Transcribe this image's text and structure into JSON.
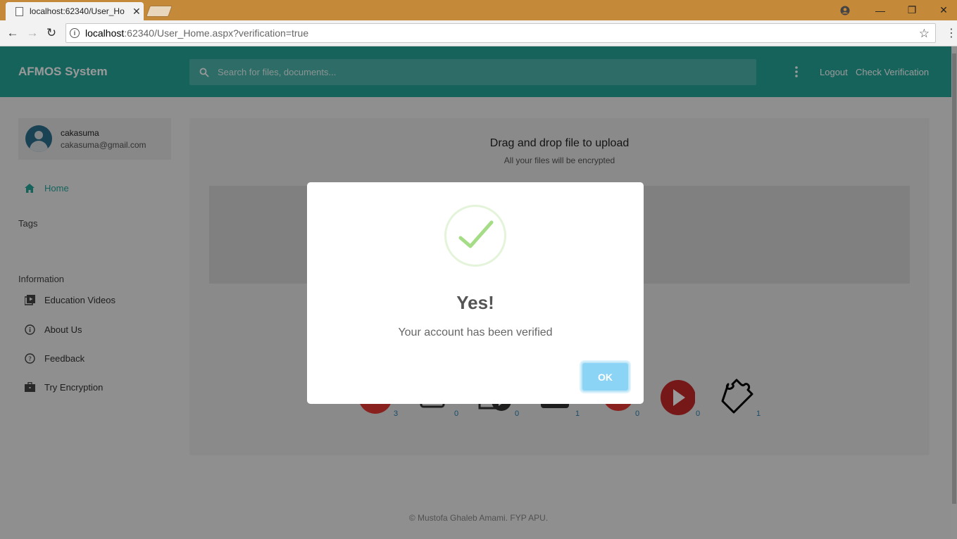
{
  "browser": {
    "tab_title": "localhost:62340/User_Ho",
    "url_host": "localhost",
    "url_rest": ":62340/User_Home.aspx?verification=true"
  },
  "header": {
    "brand": "AFMOS System",
    "search_placeholder": "Search for files, documents...",
    "logout": "Logout",
    "check_verification": "Check Verification"
  },
  "user": {
    "name": "cakasuma",
    "email": "cakasuma@gmail.com"
  },
  "sidebar": {
    "home": "Home",
    "tags_heading": "Tags",
    "information_heading": "Information",
    "items": [
      {
        "label": "Education Videos"
      },
      {
        "label": "About Us"
      },
      {
        "label": "Feedback"
      },
      {
        "label": "Try Encryption"
      }
    ]
  },
  "upload": {
    "title": "Drag and drop file to upload",
    "subtitle": "All your files will be encrypted"
  },
  "categories": [
    {
      "icon": "pdf-icon",
      "count": "3",
      "color": "#e53935"
    },
    {
      "icon": "slides-icon",
      "count": "0",
      "color": "#333333"
    },
    {
      "icon": "video-file-icon",
      "count": "0",
      "color": "#333333"
    },
    {
      "icon": "camera-icon",
      "count": "1",
      "color": "#333333"
    },
    {
      "icon": "music-icon",
      "count": "0",
      "color": "#e53935"
    },
    {
      "icon": "play-icon",
      "count": "0",
      "color": "#c62828"
    },
    {
      "icon": "puzzle-icon",
      "count": "1",
      "color": "#000000"
    }
  ],
  "footer": {
    "copyright": "© Mustofa Ghaleb Amami. FYP APU."
  },
  "modal": {
    "title": "Yes!",
    "message": "Your account has been verified",
    "ok": "OK"
  },
  "colors": {
    "accent": "#26a69a",
    "tabbar": "#c5893a",
    "success": "#a5dc86",
    "ok_button": "#8cd4f5"
  }
}
